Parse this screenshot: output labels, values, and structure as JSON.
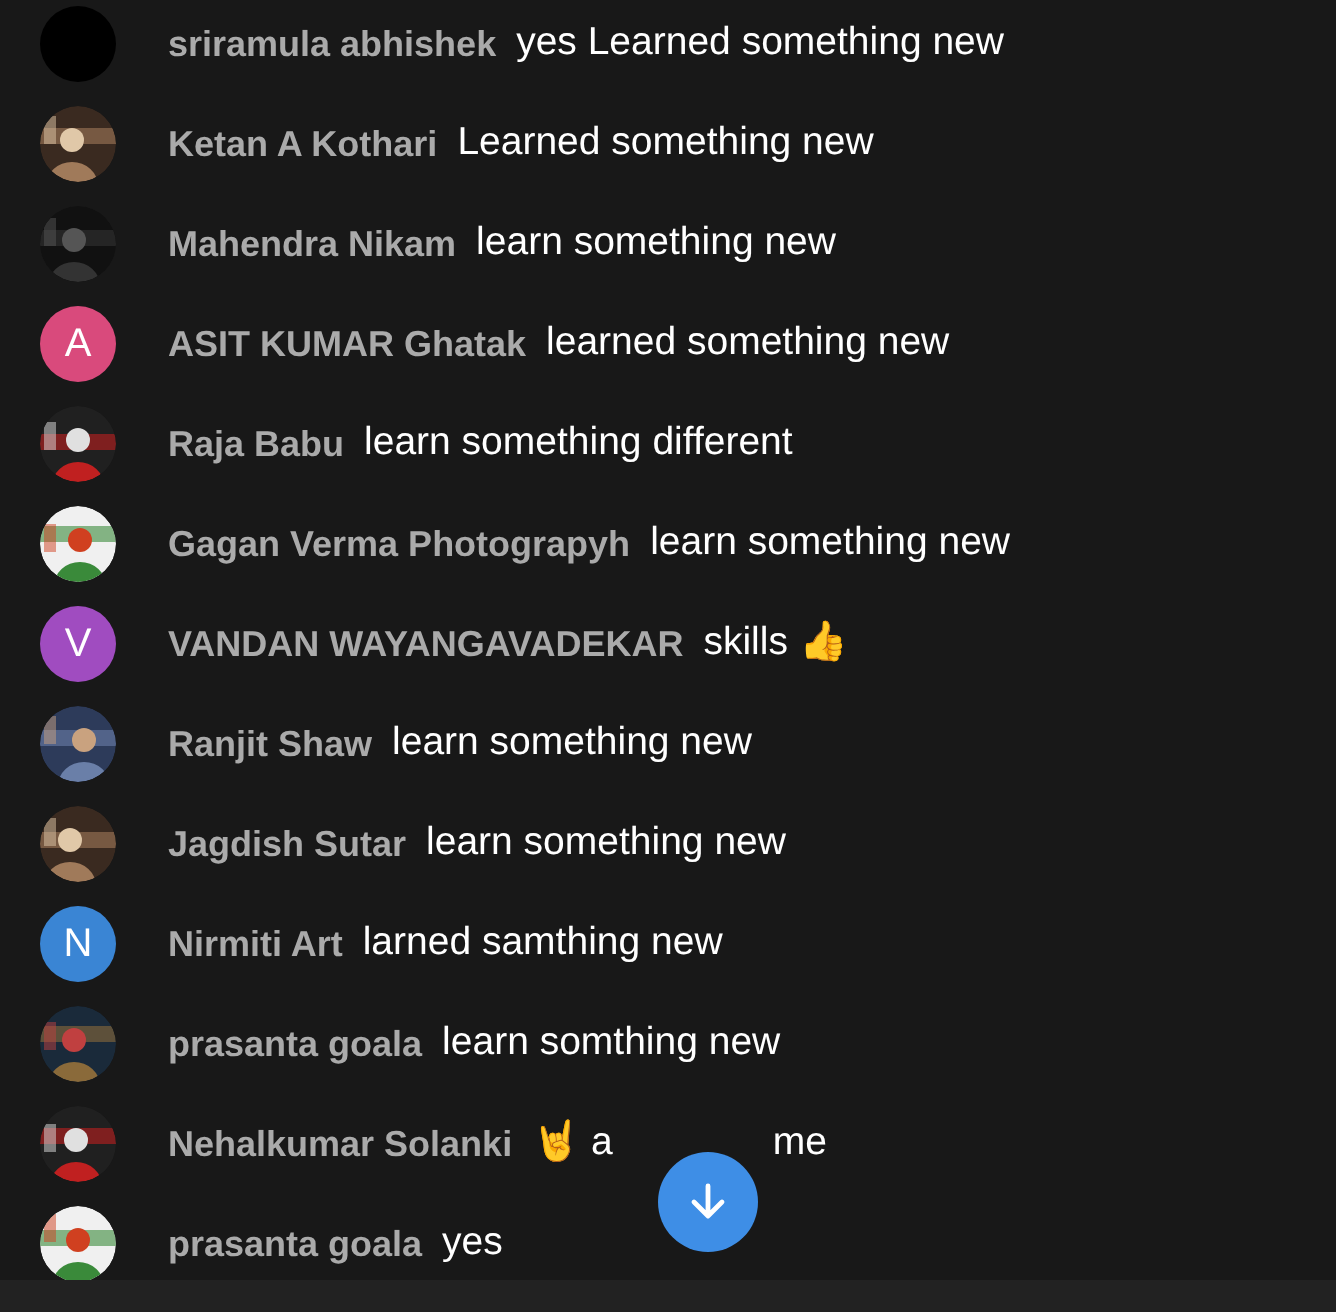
{
  "messages": [
    {
      "avatar": {
        "kind": "blank"
      },
      "author": "sriramula abhishek",
      "message": "yes Learned something new"
    },
    {
      "author": "Ketan A Kothari",
      "message": "Learned something new"
    },
    {
      "author": "Mahendra Nikam",
      "message": "learn something new"
    },
    {
      "avatar": {
        "kind": "letter",
        "letter": "A",
        "color": "#d94a7c"
      },
      "author": "ASIT KUMAR Ghatak",
      "message": "learned something new"
    },
    {
      "author": "Raja Babu",
      "message": "learn something different"
    },
    {
      "author": "Gagan Verma Photograpyh",
      "message": "learn something new"
    },
    {
      "avatar": {
        "kind": "letter",
        "letter": "V",
        "color": "#a04cc0"
      },
      "author": "VANDAN WAYANGAVADEKAR",
      "message": "skills 👍"
    },
    {
      "author": "Ranjit Shaw",
      "message": "learn something new"
    },
    {
      "author": "Jagdish Sutar",
      "message": "learn something new"
    },
    {
      "avatar": {
        "kind": "letter",
        "letter": "N",
        "color": "#3a85d4"
      },
      "author": "Nirmiti Art",
      "message": "larned samthing new"
    },
    {
      "author": "prasanta goala",
      "message": "learn somthing new"
    },
    {
      "author": "Nehalkumar Solanki",
      "message": "🤘 a",
      "message_after_cover": "me"
    },
    {
      "author": "prasanta goala",
      "message": "yes"
    }
  ],
  "scroll_down_button": {
    "kind": "arrow-down"
  }
}
